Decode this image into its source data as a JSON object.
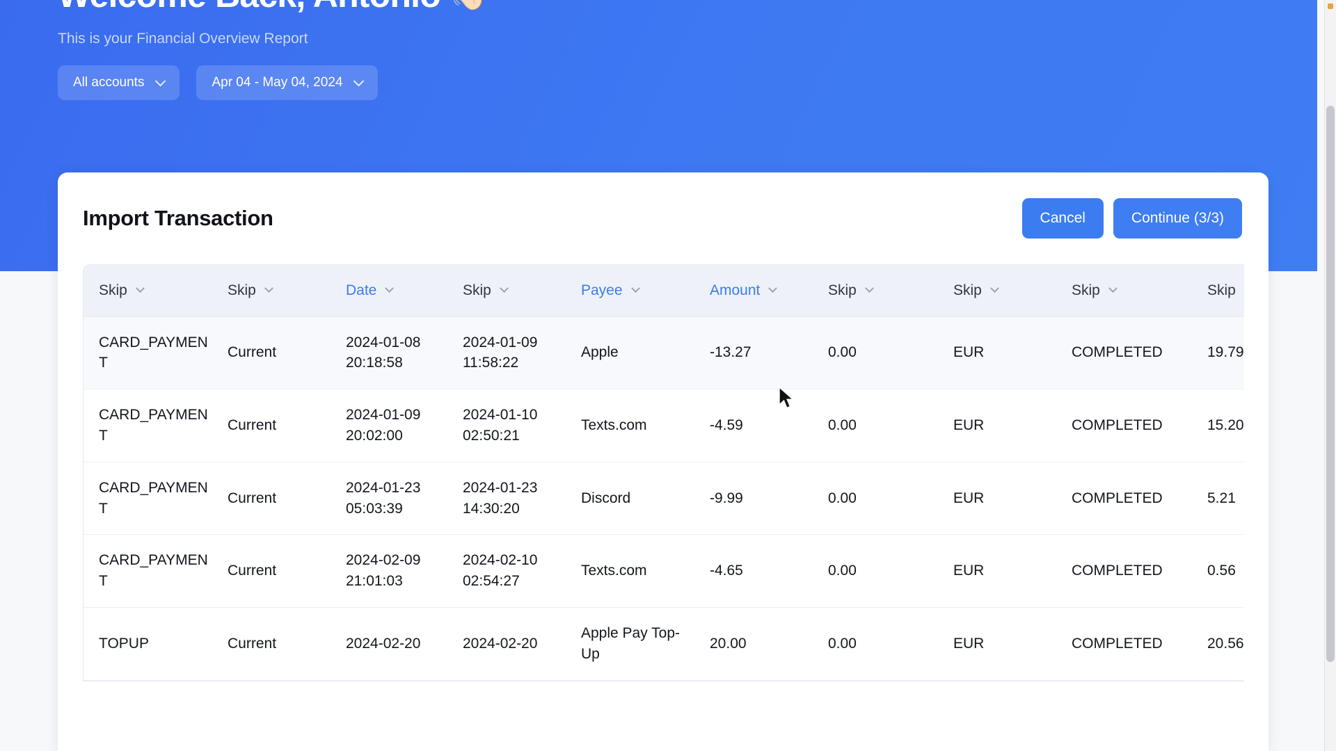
{
  "hero": {
    "greeting": "Welcome Back, Antonio",
    "wave_icon": "waving-hand-icon",
    "wave_glyph": "👋🏻",
    "subtitle": "This is your Financial Overview Report",
    "filters": [
      {
        "label": "All accounts",
        "icon": "chevron-down-icon"
      },
      {
        "label": "Apr 04 - May 04, 2024",
        "icon": "chevron-down-icon"
      }
    ],
    "background_color": "#3b6ef0"
  },
  "card": {
    "title": "Import Transaction",
    "cancel_label": "Cancel",
    "continue_label": "Continue (3/3)",
    "accent_color": "#3b7cf0"
  },
  "table": {
    "columns": [
      {
        "label": "Skip",
        "mapped": false,
        "icon": "chevron-down-icon"
      },
      {
        "label": "Skip",
        "mapped": false,
        "icon": "chevron-down-icon"
      },
      {
        "label": "Date",
        "mapped": true,
        "icon": "chevron-down-icon"
      },
      {
        "label": "Skip",
        "mapped": false,
        "icon": "chevron-down-icon"
      },
      {
        "label": "Payee",
        "mapped": true,
        "icon": "chevron-down-icon"
      },
      {
        "label": "Amount",
        "mapped": true,
        "icon": "chevron-down-icon"
      },
      {
        "label": "Skip",
        "mapped": false,
        "icon": "chevron-down-icon"
      },
      {
        "label": "Skip",
        "mapped": false,
        "icon": "chevron-down-icon"
      },
      {
        "label": "Skip",
        "mapped": false,
        "icon": "chevron-down-icon"
      },
      {
        "label": "Skip",
        "mapped": false,
        "icon": "chevron-down-icon"
      }
    ],
    "rows": [
      {
        "type": "CARD_PAYMENT",
        "product": "Current",
        "started_date": "2024-01-08 20:18:58",
        "completed_date": "2024-01-09 11:58:22",
        "payee": "Apple",
        "amount": "-13.27",
        "fee": "0.00",
        "currency": "EUR",
        "state": "COMPLETED",
        "balance": "19.79"
      },
      {
        "type": "CARD_PAYMENT",
        "product": "Current",
        "started_date": "2024-01-09 20:02:00",
        "completed_date": "2024-01-10 02:50:21",
        "payee": "Texts.com",
        "amount": "-4.59",
        "fee": "0.00",
        "currency": "EUR",
        "state": "COMPLETED",
        "balance": "15.20"
      },
      {
        "type": "CARD_PAYMENT",
        "product": "Current",
        "started_date": "2024-01-23 05:03:39",
        "completed_date": "2024-01-23 14:30:20",
        "payee": "Discord",
        "amount": "-9.99",
        "fee": "0.00",
        "currency": "EUR",
        "state": "COMPLETED",
        "balance": "5.21"
      },
      {
        "type": "CARD_PAYMENT",
        "product": "Current",
        "started_date": "2024-02-09 21:01:03",
        "completed_date": "2024-02-10 02:54:27",
        "payee": "Texts.com",
        "amount": "-4.65",
        "fee": "0.00",
        "currency": "EUR",
        "state": "COMPLETED",
        "balance": "0.56"
      },
      {
        "type": "TOPUP",
        "product": "Current",
        "started_date": "2024-02-20",
        "completed_date": "2024-02-20",
        "payee": "Apple Pay Top-Up",
        "amount": "20.00",
        "fee": "0.00",
        "currency": "EUR",
        "state": "COMPLETED",
        "balance": "20.56"
      }
    ]
  }
}
